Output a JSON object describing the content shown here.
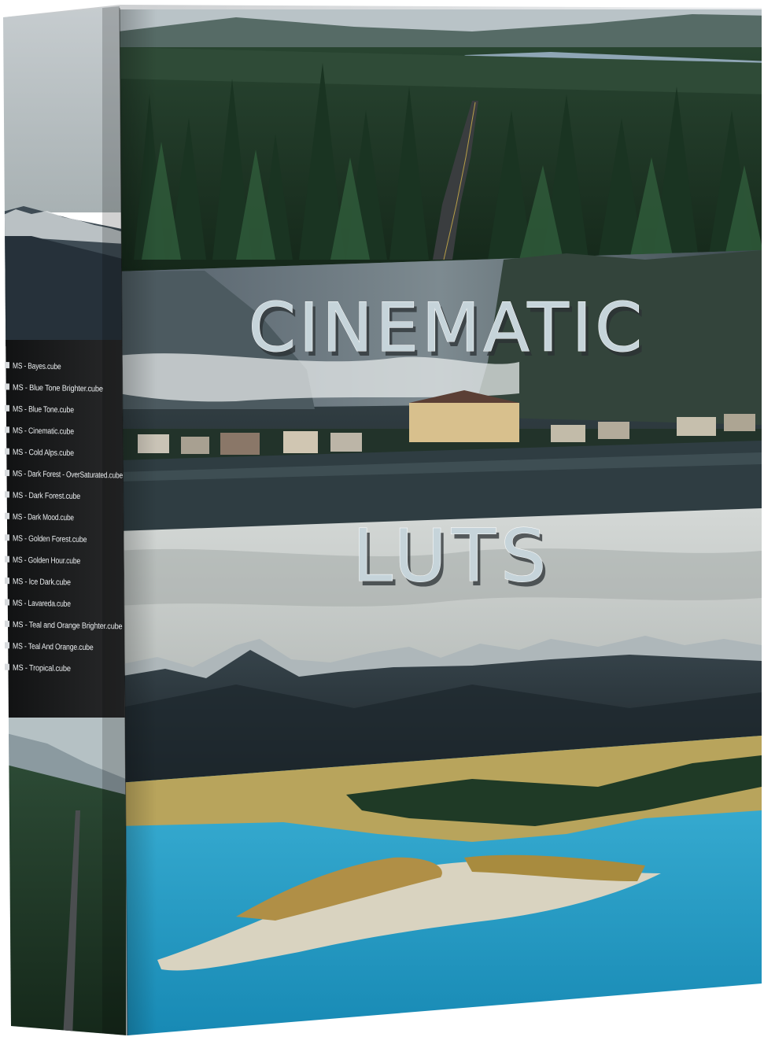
{
  "product": {
    "title_line1": "CINEMATIC",
    "title_line2": "LUTS"
  },
  "spine": {
    "files": [
      "MS - Bayes.cube",
      "MS - Blue Tone Brighter.cube",
      "MS - Blue Tone.cube",
      "MS - Cinematic.cube",
      "MS - Cold Alps.cube",
      "MS - Dark Forest - OverSaturated.cube",
      "MS - Dark Forest.cube",
      "MS - Dark Mood.cube",
      "MS - Golden Forest.cube",
      "MS - Golden Hour.cube",
      "MS - Ice Dark.cube",
      "MS - Lavareda.cube",
      "MS - Teal and Orange Brighter.cube",
      "MS - Teal And Orange.cube",
      "MS - Tropical.cube"
    ]
  },
  "colors": {
    "forest": "#1f3a26",
    "lake_teal": "#2a9dc4",
    "sky_grey": "#c9cfcf",
    "spine_dark": "#1c1c1c",
    "box_top": "#e4e6e8"
  },
  "icons": {
    "file_entry": "file-checkbox-icon"
  }
}
